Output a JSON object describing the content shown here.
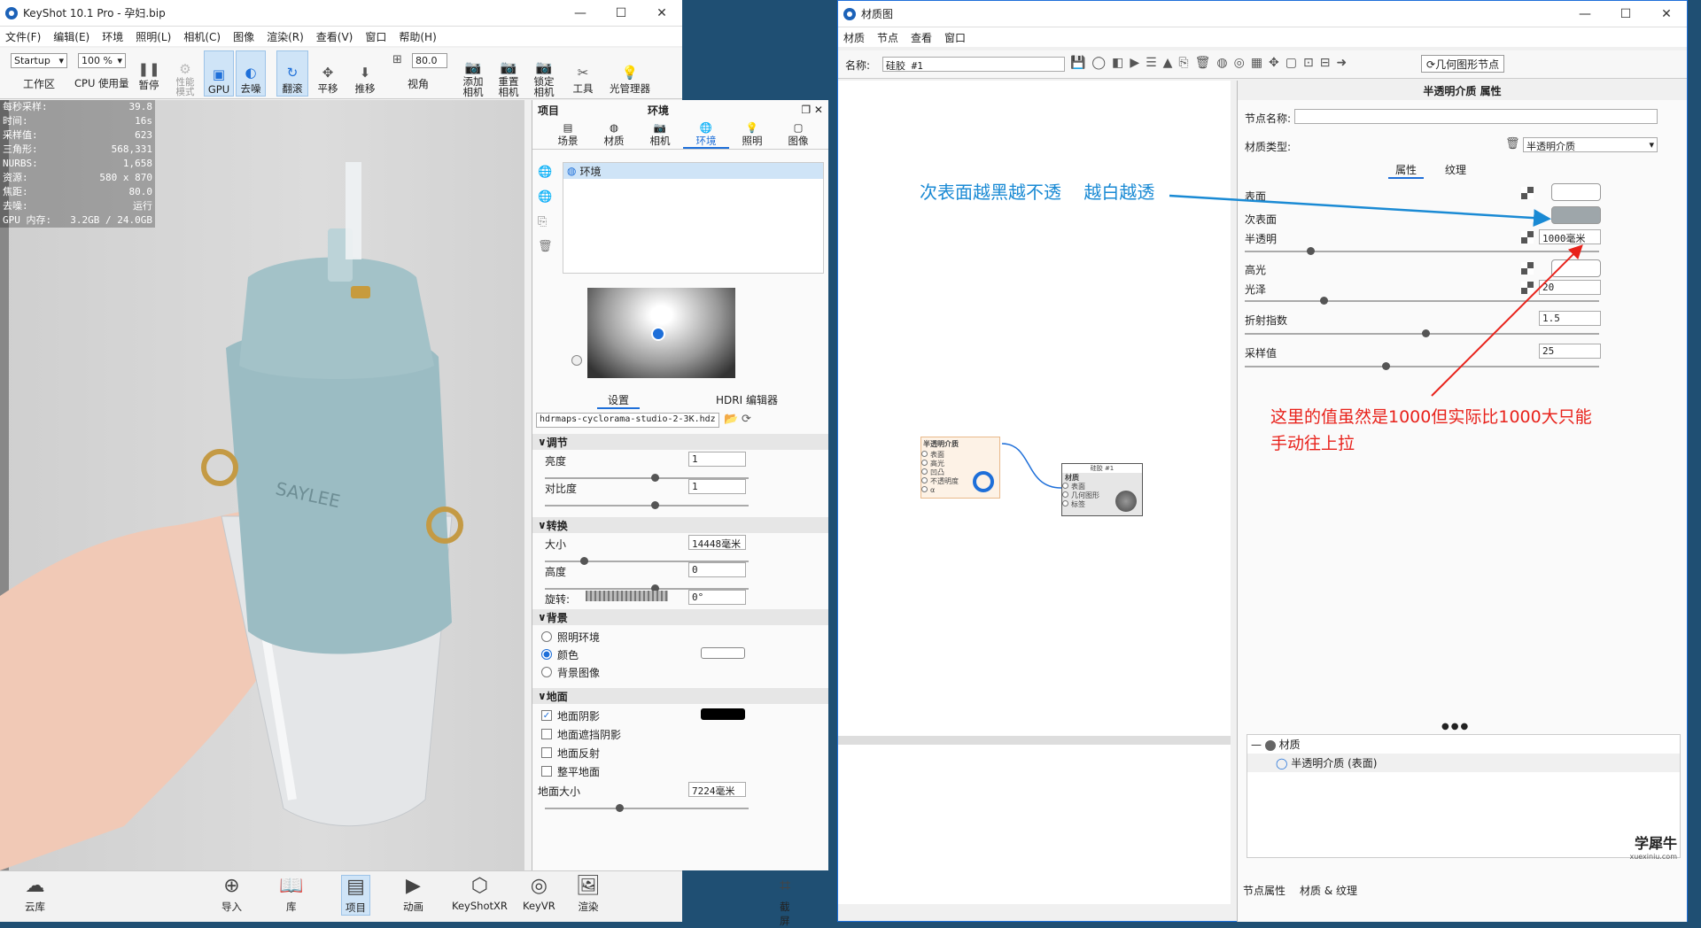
{
  "left_window": {
    "title": "KeyShot 10.1 Pro  -  孕妇.bip",
    "menus": [
      "文件(F)",
      "编辑(E)",
      "环境",
      "照明(L)",
      "相机(C)",
      "图像",
      "渲染(R)",
      "查看(V)",
      "窗口",
      "帮助(H)"
    ],
    "toolbar": {
      "workspace_value": "Startup",
      "workspace_label": "工作区",
      "cpu_pct": "100 %",
      "cpu_label": "CPU 使用量",
      "pause": "暂停",
      "perf_mode": "性能\n模式",
      "gpu": "GPU",
      "denoise": "去噪",
      "tumble": "翻滚",
      "pan": "平移",
      "dolly": "推移",
      "fov_value": "80.0",
      "fov_label": "视角",
      "add_camera": "添加\n相机",
      "reset_camera": "重置\n相机",
      "lock_camera": "锁定\n相机",
      "tools": "工具",
      "light_manager": "光管理器"
    },
    "stats": [
      {
        "k": "每秒采样:",
        "v": "39.8"
      },
      {
        "k": "时间:",
        "v": "16s"
      },
      {
        "k": "采样值:",
        "v": "623"
      },
      {
        "k": "三角形:",
        "v": "568,331"
      },
      {
        "k": "NURBS:",
        "v": "1,658"
      },
      {
        "k": "资源:",
        "v": "580 x 870"
      },
      {
        "k": "焦距:",
        "v": "80.0"
      },
      {
        "k": "去噪:",
        "v": "运行"
      },
      {
        "k": "GPU 内存:",
        "v": "3.2GB / 24.0GB"
      }
    ],
    "bottle_brand": "SAYLEE",
    "bottom_bar": [
      "云库",
      "导入",
      "库",
      "项目",
      "动画",
      "KeyShotXR",
      "KeyVR",
      "渲染",
      "截屏"
    ]
  },
  "project_panel": {
    "header_left": "项目",
    "header_center": "环境",
    "tabs": [
      "场景",
      "材质",
      "相机",
      "环境",
      "照明",
      "图像"
    ],
    "env_item": "环境",
    "subtabs": [
      "设置",
      "HDRI 编辑器"
    ],
    "hdri_file": "hdrmaps-cyclorama-studio-2-3K.hdz",
    "sections": {
      "adjust": "调节",
      "brightness_label": "亮度",
      "brightness": "1",
      "contrast_label": "对比度",
      "contrast": "1",
      "transform": "转换",
      "size_label": "大小",
      "size": "14448毫米",
      "height_label": "高度",
      "height": "0",
      "rotation_label": "旋转:",
      "rotation": "0°",
      "background": "背景",
      "bg_light_env": "照明环境",
      "bg_color": "颜色",
      "bg_image": "背景图像",
      "ground": "地面",
      "ground_shadow": "地面阴影",
      "ground_occlusion": "地面遮挡阴影",
      "ground_reflect": "地面反射",
      "flatten_ground": "整平地面",
      "ground_size_label": "地面大小",
      "ground_size": "7224毫米"
    }
  },
  "material_window": {
    "title": "材质图",
    "menus": [
      "材质",
      "节点",
      "查看",
      "窗口"
    ],
    "name_label": "名称:",
    "name_value": "硅胶 #1",
    "geo_node_btn": "几何图形节点",
    "nodes": {
      "subsurface_title": "半透明介质",
      "subsurface_pins": [
        "表面",
        "高光",
        "凹凸",
        "不透明度",
        "α"
      ],
      "material_title": "材质",
      "material_header": "硅胶 #1",
      "material_pins": [
        "表面",
        "几何图形",
        "标签"
      ]
    },
    "props": {
      "header": "半透明介质  属性",
      "node_name_label": "节点名称:",
      "node_name": "",
      "mat_type_label": "材质类型:",
      "mat_type": "半透明介质",
      "tabs": [
        "属性",
        "纹理"
      ],
      "surface": "表面",
      "subsurface": "次表面",
      "translucency": "半透明",
      "translucency_value": "1000毫米",
      "specular": "高光",
      "roughness": "光泽",
      "roughness_value": "20",
      "ior": "折射指数",
      "ior_value": "1.5",
      "samples": "采样值",
      "samples_value": "25",
      "tree_root": "材质",
      "tree_child": "半透明介质 (表面)",
      "bottom_tabs": [
        "节点属性",
        "材质 & 纹理"
      ]
    },
    "annotation_blue": "次表面越黑越不透    越白越透",
    "annotation_red": "这里的值虽然是1000但实际比1000大只能\n手动往上拉",
    "watermark": "学犀牛",
    "watermark_url": "xuexiniu.com"
  },
  "colors": {
    "accent": "#1e6fd9",
    "red_note": "#e8221b",
    "blue_note": "#1a8ad4"
  }
}
